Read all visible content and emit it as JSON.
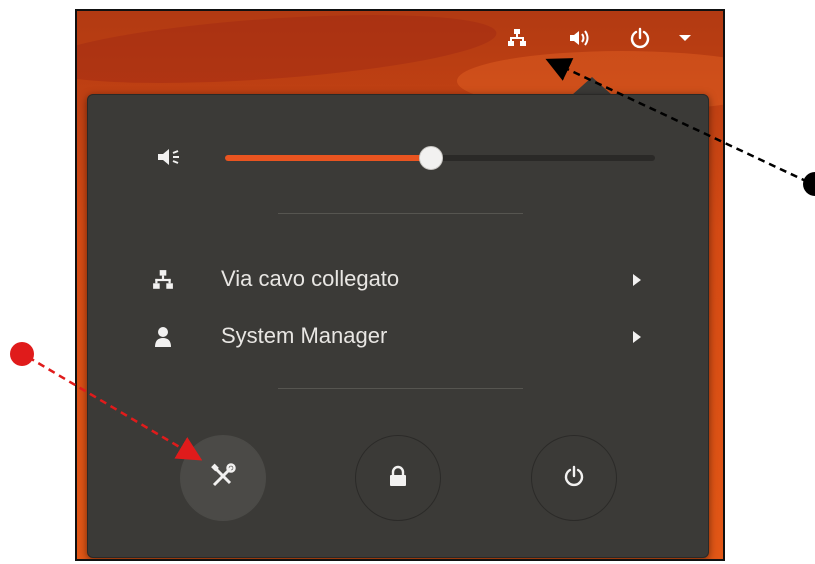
{
  "colors": {
    "accent": "#e95420",
    "menu_bg": "#3b3a37",
    "panel_bg": "#c64816",
    "text": "#e8e6e3",
    "annotation_black": "#000000",
    "annotation_red": "#e01b1b"
  },
  "top_bar": {
    "indicators": [
      {
        "icon": "network-wired-icon"
      },
      {
        "icon": "volume-icon"
      },
      {
        "icon": "power-icon"
      },
      {
        "icon": "dropdown-arrow-icon"
      }
    ]
  },
  "menu": {
    "volume": {
      "icon": "volume-low-icon",
      "level": 0.48
    },
    "items": [
      {
        "icon": "network-wired-icon",
        "label": "Via cavo collegato",
        "submenu_icon": "triangle-right-icon"
      },
      {
        "icon": "user-icon",
        "label": "System Manager",
        "submenu_icon": "triangle-right-icon"
      }
    ],
    "actions": [
      {
        "icon": "settings-tools-icon",
        "active": true
      },
      {
        "icon": "lock-icon",
        "active": false
      },
      {
        "icon": "power-icon",
        "active": false
      }
    ]
  }
}
